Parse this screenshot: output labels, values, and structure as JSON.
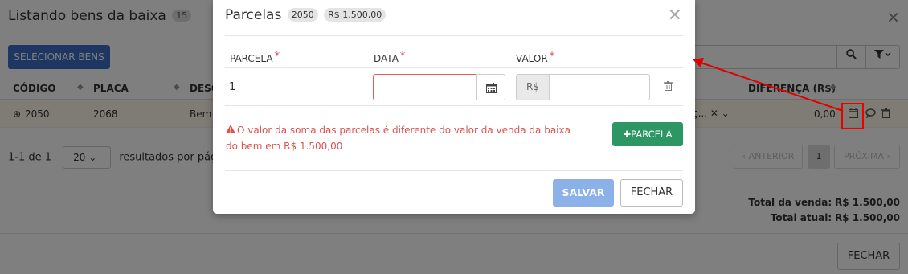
{
  "background": {
    "title": "Listando bens da baixa",
    "count": "15",
    "select_button": "SELECIONAR BENS",
    "columns": {
      "codigo": "CÓDIGO",
      "placa": "PLACA",
      "desc": "DESC",
      "diferenca": "DIFERENÇA (R$)"
    },
    "row": {
      "codigo": "2050",
      "placa": "2068",
      "desc": "Bem",
      "diferenca": "0,00",
      "select_cut": "ç..."
    },
    "pager": {
      "range": "1-1 de 1",
      "page_size": "20",
      "results_text": "resultados por pág",
      "prev": "‹ ANTERIOR",
      "page": "1",
      "next": "PRÓXIMA ›"
    },
    "totals": {
      "venda_label": "Total da venda:",
      "venda_value": "R$ 1.500,00",
      "atual_label": "Total atual:",
      "atual_value": "R$ 1.500,00"
    },
    "close_button": "FECHAR"
  },
  "modal": {
    "title": "Parcelas",
    "badge_code": "2050",
    "badge_value": "R$ 1.500,00",
    "headers": {
      "parcela": "PARCELA",
      "data": "DATA",
      "valor": "VALOR",
      "required_mark": "*"
    },
    "rows": [
      {
        "parcela": "1",
        "data": "",
        "currency": "R$",
        "valor": ""
      }
    ],
    "error_message": "O valor da soma das parcelas é diferente do valor da venda da baixa do bem em R$ 1.500,00",
    "add_button": "PARCELA",
    "save_button": "SALVAR",
    "close_button": "FECHAR"
  },
  "colors": {
    "primary": "#3c6fc5",
    "success": "#2d9763",
    "danger": "#d9534f",
    "annotation": "#e00000"
  }
}
